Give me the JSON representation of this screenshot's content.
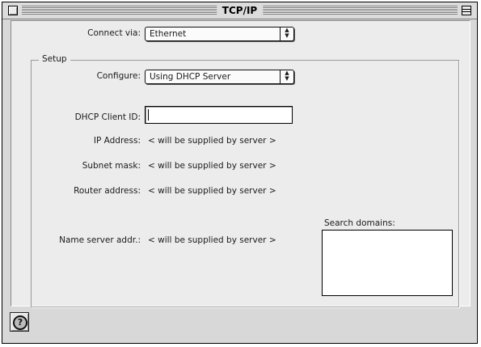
{
  "window": {
    "title": "TCP/IP"
  },
  "connect_via": {
    "label": "Connect via:",
    "value": "Ethernet"
  },
  "setup": {
    "group_title": "Setup",
    "configure": {
      "label": "Configure:",
      "value": "Using DHCP Server"
    },
    "dhcp_client_id": {
      "label": "DHCP Client ID:",
      "value": ""
    },
    "ip_address": {
      "label": "IP Address:",
      "value": "< will be supplied by server >"
    },
    "subnet_mask": {
      "label": "Subnet mask:",
      "value": "< will be supplied by server >"
    },
    "router_address": {
      "label": "Router address:",
      "value": "< will be supplied by server >"
    },
    "name_server": {
      "label": "Name server addr.:",
      "value": "< will be supplied by server >"
    },
    "search_domains": {
      "label": "Search domains:",
      "value": ""
    }
  },
  "help": {
    "glyph": "?",
    "icon": "help-question-icon"
  }
}
